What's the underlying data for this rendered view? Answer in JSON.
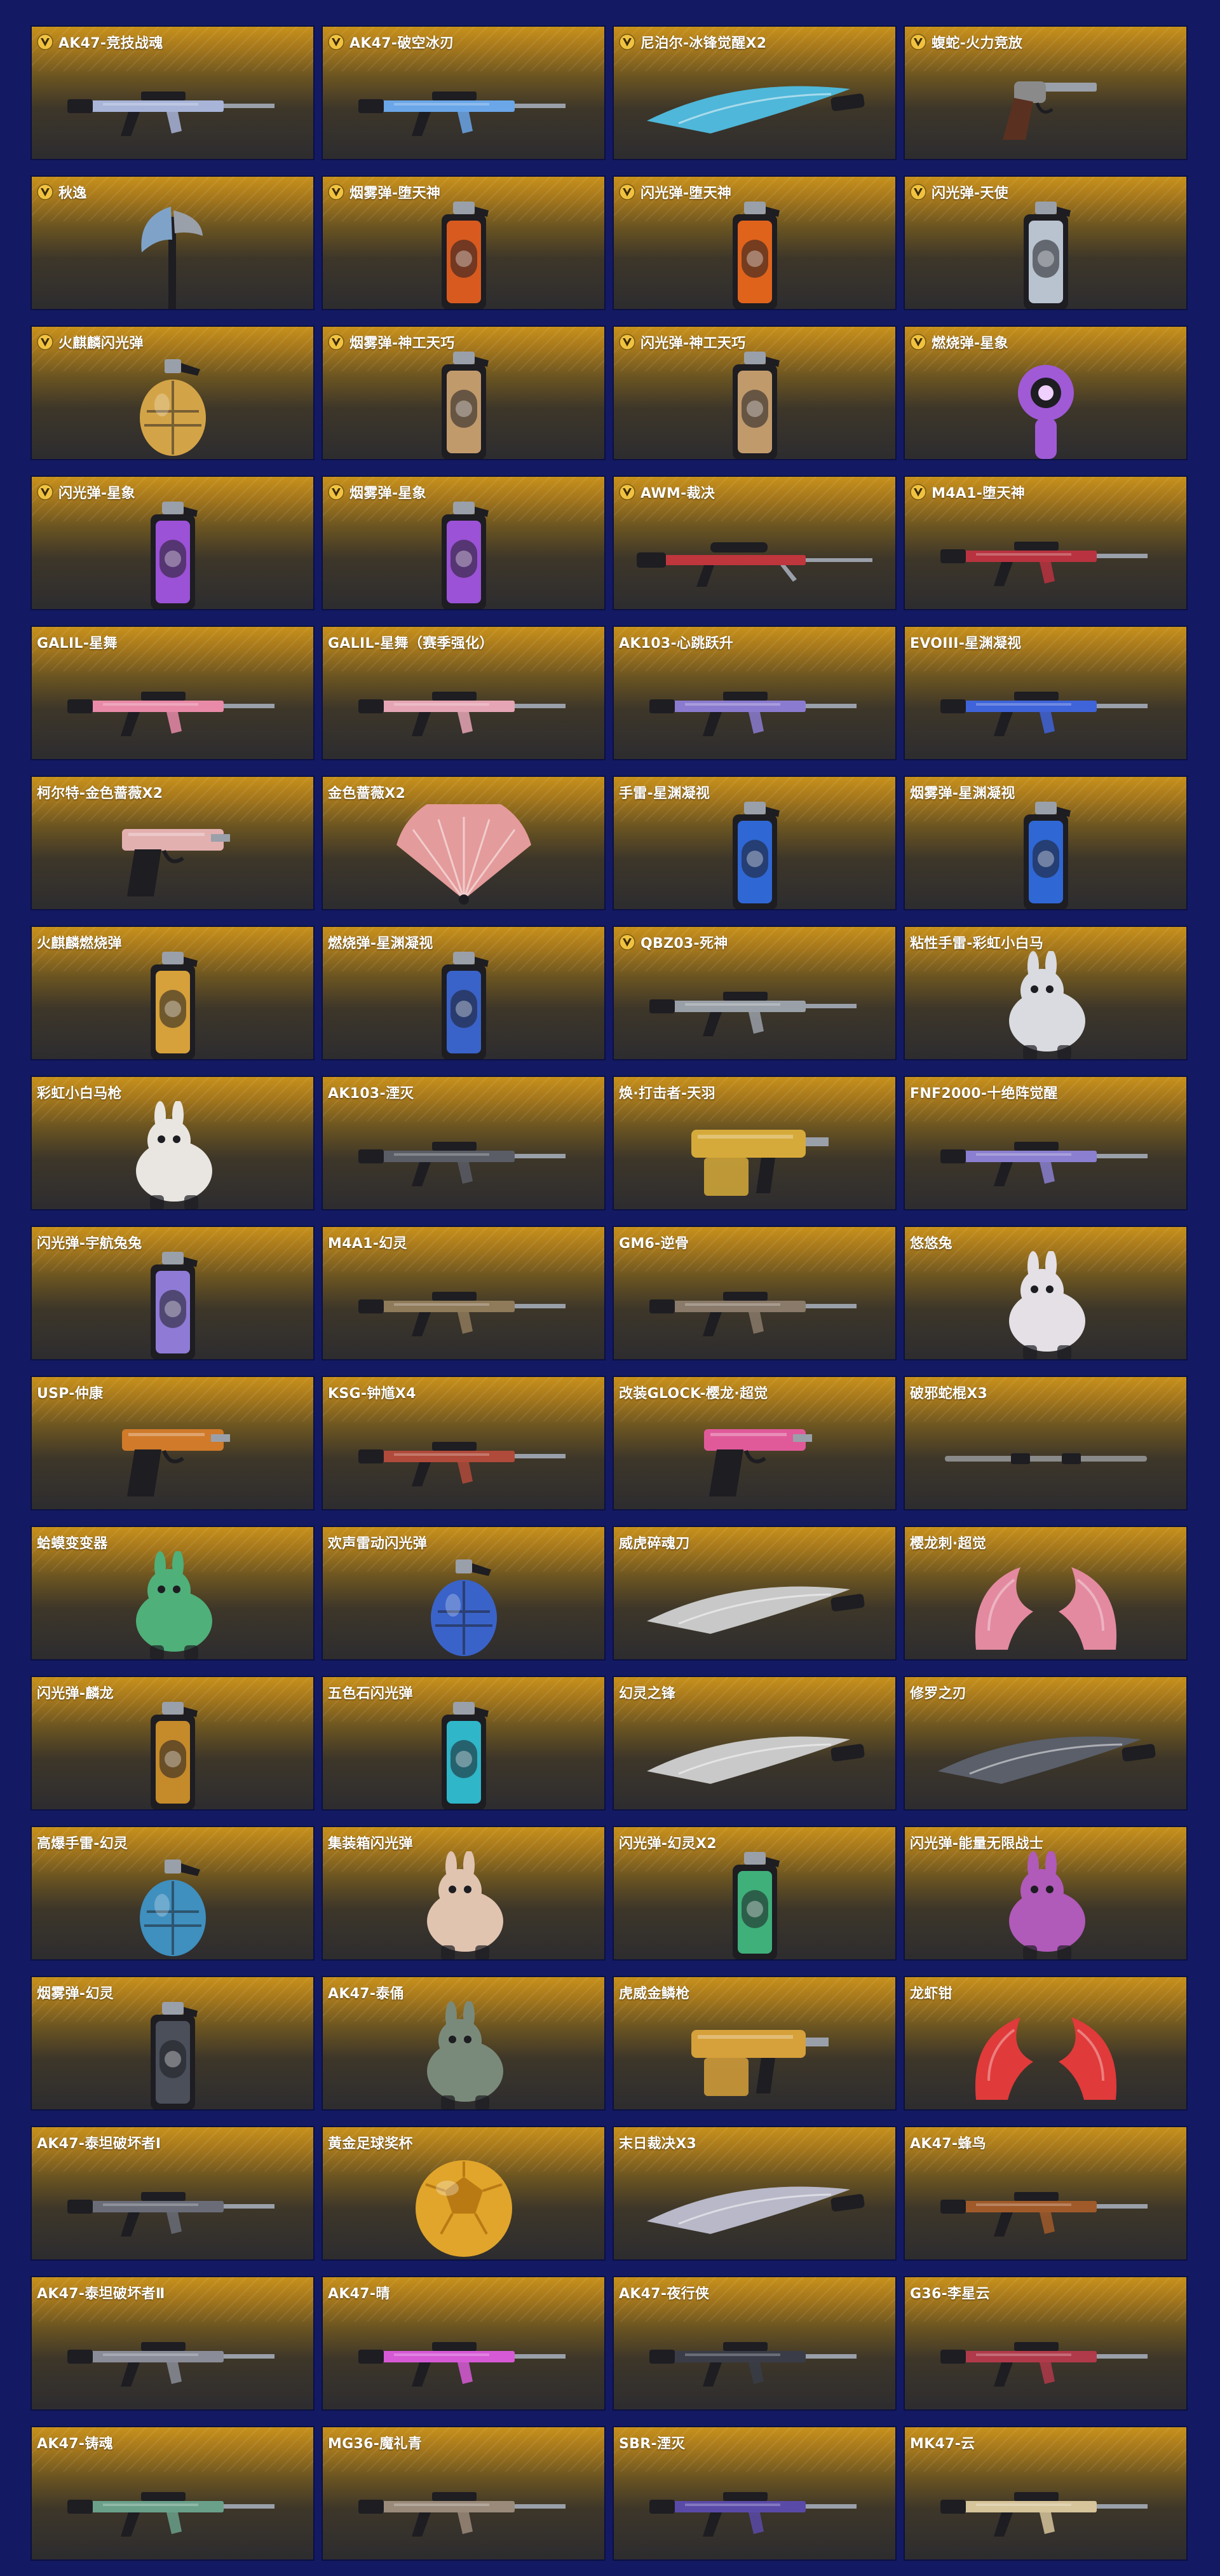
{
  "colors": {
    "page_background": "#131a63",
    "card_gold": "#c8911b",
    "card_dark": "#2d2c2f",
    "title_text": "#ffffff",
    "vip_badge": "#f0c240"
  },
  "items": [
    {
      "name": "AK47-竞技战魂",
      "vip": true,
      "icon": "rifle-icon",
      "color": "#a8b4d8"
    },
    {
      "name": "AK47-破空冰刃",
      "vip": true,
      "icon": "rifle-icon",
      "color": "#6aa6e8"
    },
    {
      "name": "尼泊尔-冰锋觉醒X2",
      "vip": true,
      "icon": "blade-icon",
      "color": "#4fb7d9"
    },
    {
      "name": "蝮蛇-火力竞放",
      "vip": true,
      "icon": "revolver-icon",
      "color": "#8a8a8a"
    },
    {
      "name": "秋逸",
      "vip": true,
      "icon": "axe-icon",
      "color": "#7fa3c8"
    },
    {
      "name": "烟雾弹-堕天神",
      "vip": true,
      "icon": "canister-icon",
      "color": "#d95a1f"
    },
    {
      "name": "闪光弹-堕天神",
      "vip": true,
      "icon": "canister-icon",
      "color": "#e0631c"
    },
    {
      "name": "闪光弹-天使",
      "vip": true,
      "icon": "canister-icon",
      "color": "#b9c3cf"
    },
    {
      "name": "火麒麟闪光弹",
      "vip": true,
      "icon": "grenade-icon",
      "color": "#d3a447"
    },
    {
      "name": "烟雾弹-神工天巧",
      "vip": true,
      "icon": "canister-icon",
      "color": "#c19a6b"
    },
    {
      "name": "闪光弹-神工天巧",
      "vip": true,
      "icon": "canister-icon",
      "color": "#c19a6b"
    },
    {
      "name": "燃烧弹-星象",
      "vip": true,
      "icon": "orb-icon",
      "color": "#a05ad6"
    },
    {
      "name": "闪光弹-星象",
      "vip": true,
      "icon": "canister-icon",
      "color": "#9b52d6"
    },
    {
      "name": "烟雾弹-星象",
      "vip": true,
      "icon": "canister-icon",
      "color": "#9b52d6"
    },
    {
      "name": "AWM-裁决",
      "vip": true,
      "icon": "sniper-icon",
      "color": "#c0363d"
    },
    {
      "name": "M4A1-堕天神",
      "vip": true,
      "icon": "rifle-icon",
      "color": "#b8333f"
    },
    {
      "name": "GALIL-星舞",
      "vip": false,
      "icon": "rifle-icon",
      "color": "#e88aa8"
    },
    {
      "name": "GALIL-星舞（赛季强化）",
      "vip": false,
      "icon": "rifle-icon",
      "color": "#e6a5b5"
    },
    {
      "name": "AK103-心跳跃升",
      "vip": false,
      "icon": "rifle-icon",
      "color": "#8b7bd0"
    },
    {
      "name": "EVOIII-星渊凝视",
      "vip": false,
      "icon": "rifle-icon",
      "color": "#3f63d8"
    },
    {
      "name": "柯尔特-金色蔷薇X2",
      "vip": false,
      "icon": "pistol-icon",
      "color": "#e3b0b0"
    },
    {
      "name": "金色蔷薇X2",
      "vip": false,
      "icon": "fan-icon",
      "color": "#e49b9b"
    },
    {
      "name": "手雷-星渊凝视",
      "vip": false,
      "icon": "canister-icon",
      "color": "#2f67d4"
    },
    {
      "name": "烟雾弹-星渊凝视",
      "vip": false,
      "icon": "canister-icon",
      "color": "#2f67d4"
    },
    {
      "name": "火麒麟燃烧弹",
      "vip": false,
      "icon": "canister-icon",
      "color": "#d6a13a"
    },
    {
      "name": "燃烧弹-星渊凝视",
      "vip": false,
      "icon": "canister-icon",
      "color": "#3a63c9"
    },
    {
      "name": "QBZ03-死神",
      "vip": true,
      "icon": "rifle-icon",
      "color": "#9aa0a8"
    },
    {
      "name": "粘性手雷-彩虹小白马",
      "vip": false,
      "icon": "creature-icon",
      "color": "#d9dbe0"
    },
    {
      "name": "彩虹小白马枪",
      "vip": false,
      "icon": "creature-icon",
      "color": "#e9e6e2"
    },
    {
      "name": "AK103-湮灭",
      "vip": false,
      "icon": "rifle-icon",
      "color": "#5a5d66"
    },
    {
      "name": "焕·打击者-天羽",
      "vip": false,
      "icon": "heavy-gun-icon",
      "color": "#d6aa3a"
    },
    {
      "name": "FNF2000-十绝阵觉醒",
      "vip": false,
      "icon": "rifle-icon",
      "color": "#8a7fd0"
    },
    {
      "name": "闪光弹-宇航兔兔",
      "vip": false,
      "icon": "canister-icon",
      "color": "#8f7ad6"
    },
    {
      "name": "M4A1-幻灵",
      "vip": false,
      "icon": "rifle-icon",
      "color": "#8f7a5a"
    },
    {
      "name": "GM6-逆骨",
      "vip": false,
      "icon": "rifle-icon",
      "color": "#8a7a6a"
    },
    {
      "name": "悠悠兔",
      "vip": false,
      "icon": "creature-icon",
      "color": "#e4e0e6"
    },
    {
      "name": "USP-仲康",
      "vip": false,
      "icon": "pistol-icon",
      "color": "#d07a2a"
    },
    {
      "name": "KSG-钟馗X4",
      "vip": false,
      "icon": "rifle-icon",
      "color": "#b04a3a"
    },
    {
      "name": "改装GLOCK-樱龙·超觉",
      "vip": false,
      "icon": "pistol-icon",
      "color": "#e05a9a"
    },
    {
      "name": "破邪蛇棍X3",
      "vip": false,
      "icon": "staff-icon",
      "color": "#8a8a8a"
    },
    {
      "name": "蛤蟆变变器",
      "vip": false,
      "icon": "creature-icon",
      "color": "#4fb07a"
    },
    {
      "name": "欢声雷动闪光弹",
      "vip": false,
      "icon": "grenade-icon",
      "color": "#3a63c9"
    },
    {
      "name": "威虎碎魂刀",
      "vip": false,
      "icon": "blade-icon",
      "color": "#c8c8c8"
    },
    {
      "name": "樱龙刺·超觉",
      "vip": false,
      "icon": "claw-icon",
      "color": "#e38aa0"
    },
    {
      "name": "闪光弹-麟龙",
      "vip": false,
      "icon": "canister-icon",
      "color": "#c58a2a"
    },
    {
      "name": "五色石闪光弹",
      "vip": false,
      "icon": "canister-icon",
      "color": "#2fb6c9"
    },
    {
      "name": "幻灵之锋",
      "vip": false,
      "icon": "blade-icon",
      "color": "#c9c9c9"
    },
    {
      "name": "修罗之刃",
      "vip": false,
      "icon": "blade-icon",
      "color": "#5a5f6a"
    },
    {
      "name": "高爆手雷-幻灵",
      "vip": false,
      "icon": "grenade-icon",
      "color": "#3f8fbf"
    },
    {
      "name": "集装箱闪光弹",
      "vip": false,
      "icon": "creature-icon",
      "color": "#e0c4b0"
    },
    {
      "name": "闪光弹-幻灵X2",
      "vip": false,
      "icon": "canister-icon",
      "color": "#3fb07a"
    },
    {
      "name": "闪光弹-能量无限战士",
      "vip": false,
      "icon": "creature-icon",
      "color": "#b05ab9"
    },
    {
      "name": "烟雾弹-幻灵",
      "vip": false,
      "icon": "canister-icon",
      "color": "#4a4f5a"
    },
    {
      "name": "AK47-泰俑",
      "vip": false,
      "icon": "creature-icon",
      "color": "#7a8a7a"
    },
    {
      "name": "虎威金鳞枪",
      "vip": false,
      "icon": "heavy-gun-icon",
      "color": "#d6a03a"
    },
    {
      "name": "龙虾钳",
      "vip": false,
      "icon": "claw-icon",
      "color": "#e03a3a"
    },
    {
      "name": "AK47-泰坦破坏者Ⅰ",
      "vip": false,
      "icon": "rifle-icon",
      "color": "#6a6d78"
    },
    {
      "name": "黄金足球奖杯",
      "vip": false,
      "icon": "ball-icon",
      "color": "#e0a52a"
    },
    {
      "name": "末日裁决X3",
      "vip": false,
      "icon": "blade-icon",
      "color": "#b8b8c8"
    },
    {
      "name": "AK47-蜂鸟",
      "vip": false,
      "icon": "rifle-icon",
      "color": "#a05a2a"
    },
    {
      "name": "AK47-泰坦破坏者Ⅱ",
      "vip": false,
      "icon": "rifle-icon",
      "color": "#8a8d98"
    },
    {
      "name": "AK47-晴",
      "vip": false,
      "icon": "rifle-icon",
      "color": "#d65ad6"
    },
    {
      "name": "AK47-夜行侠",
      "vip": false,
      "icon": "rifle-icon",
      "color": "#3a3d48"
    },
    {
      "name": "G36-李星云",
      "vip": false,
      "icon": "rifle-icon",
      "color": "#b03a4a"
    },
    {
      "name": "AK47-铸魂",
      "vip": false,
      "icon": "rifle-icon",
      "color": "#6aa08a"
    },
    {
      "name": "MG36-魔礼青",
      "vip": false,
      "icon": "rifle-icon",
      "color": "#9a8a7a"
    },
    {
      "name": "SBR-湮灭",
      "vip": false,
      "icon": "rifle-icon",
      "color": "#5a4aa8"
    },
    {
      "name": "MK47-云",
      "vip": false,
      "icon": "rifle-icon",
      "color": "#d6c49a"
    }
  ]
}
